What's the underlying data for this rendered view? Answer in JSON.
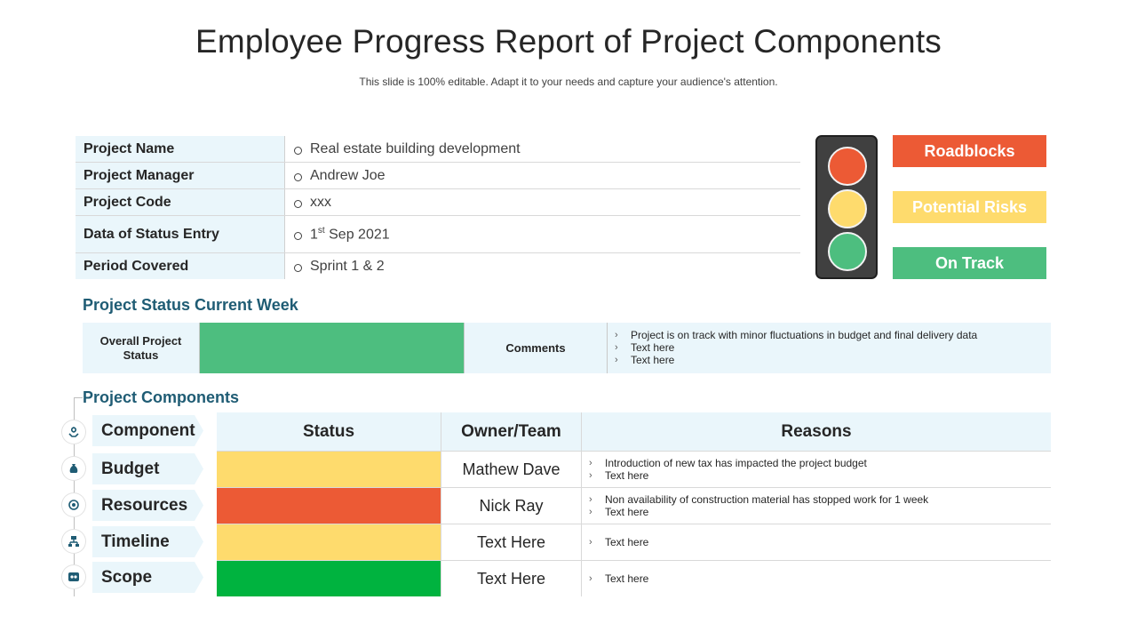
{
  "title": "Employee Progress Report of Project Components",
  "subtitle": "This slide is 100% editable. Adapt it to your needs and capture your audience's attention.",
  "info": [
    {
      "label": "Project Name",
      "value": "Real estate building development"
    },
    {
      "label": "Project Manager",
      "value": "Andrew Joe"
    },
    {
      "label": "Project Code",
      "value": "xxx"
    },
    {
      "label": "Data of Status Entry",
      "value_prefix": "1",
      "value_sup": "st",
      "value_suffix": " Sep 2021"
    },
    {
      "label": "Period Covered",
      "value": "Sprint 1 & 2"
    }
  ],
  "legend": {
    "roadblocks": "Roadblocks",
    "risks": "Potential Risks",
    "on_track": "On Track"
  },
  "colors": {
    "red": "#ec5a35",
    "yellow": "#fedb6d",
    "green": "#4dbe7f",
    "bright_green": "#00b33f",
    "teal_text": "#1f5c74",
    "light_blue": "#eaf6fb"
  },
  "status_section": {
    "heading": "Project Status Current Week",
    "overall_label": "Overall Project Status",
    "comments_label": "Comments",
    "comments": [
      "Project is on track with minor fluctuations in budget and final delivery data",
      "Text here",
      "Text here"
    ]
  },
  "components_section": {
    "heading": "Project Components",
    "headers": {
      "component": "Component",
      "status": "Status",
      "owner": "Owner/Team",
      "reasons": "Reasons"
    },
    "rows": [
      {
        "component": "Budget",
        "icon": "money-bag-icon",
        "status": "yellow",
        "owner": "Mathew Dave",
        "reasons": [
          "Introduction of new tax has impacted the project budget",
          "Text here"
        ]
      },
      {
        "component": "Resources",
        "icon": "resources-icon",
        "status": "red",
        "owner": "Nick Ray",
        "reasons": [
          "Non availability of construction material has stopped work for 1 week",
          "Text here"
        ]
      },
      {
        "component": "Timeline",
        "icon": "timeline-icon",
        "status": "yellow",
        "owner": "Text Here",
        "reasons": [
          "Text here"
        ]
      },
      {
        "component": "Scope",
        "icon": "scope-icon",
        "status": "bright_green",
        "owner": "Text Here",
        "reasons": [
          "Text here"
        ]
      }
    ]
  }
}
